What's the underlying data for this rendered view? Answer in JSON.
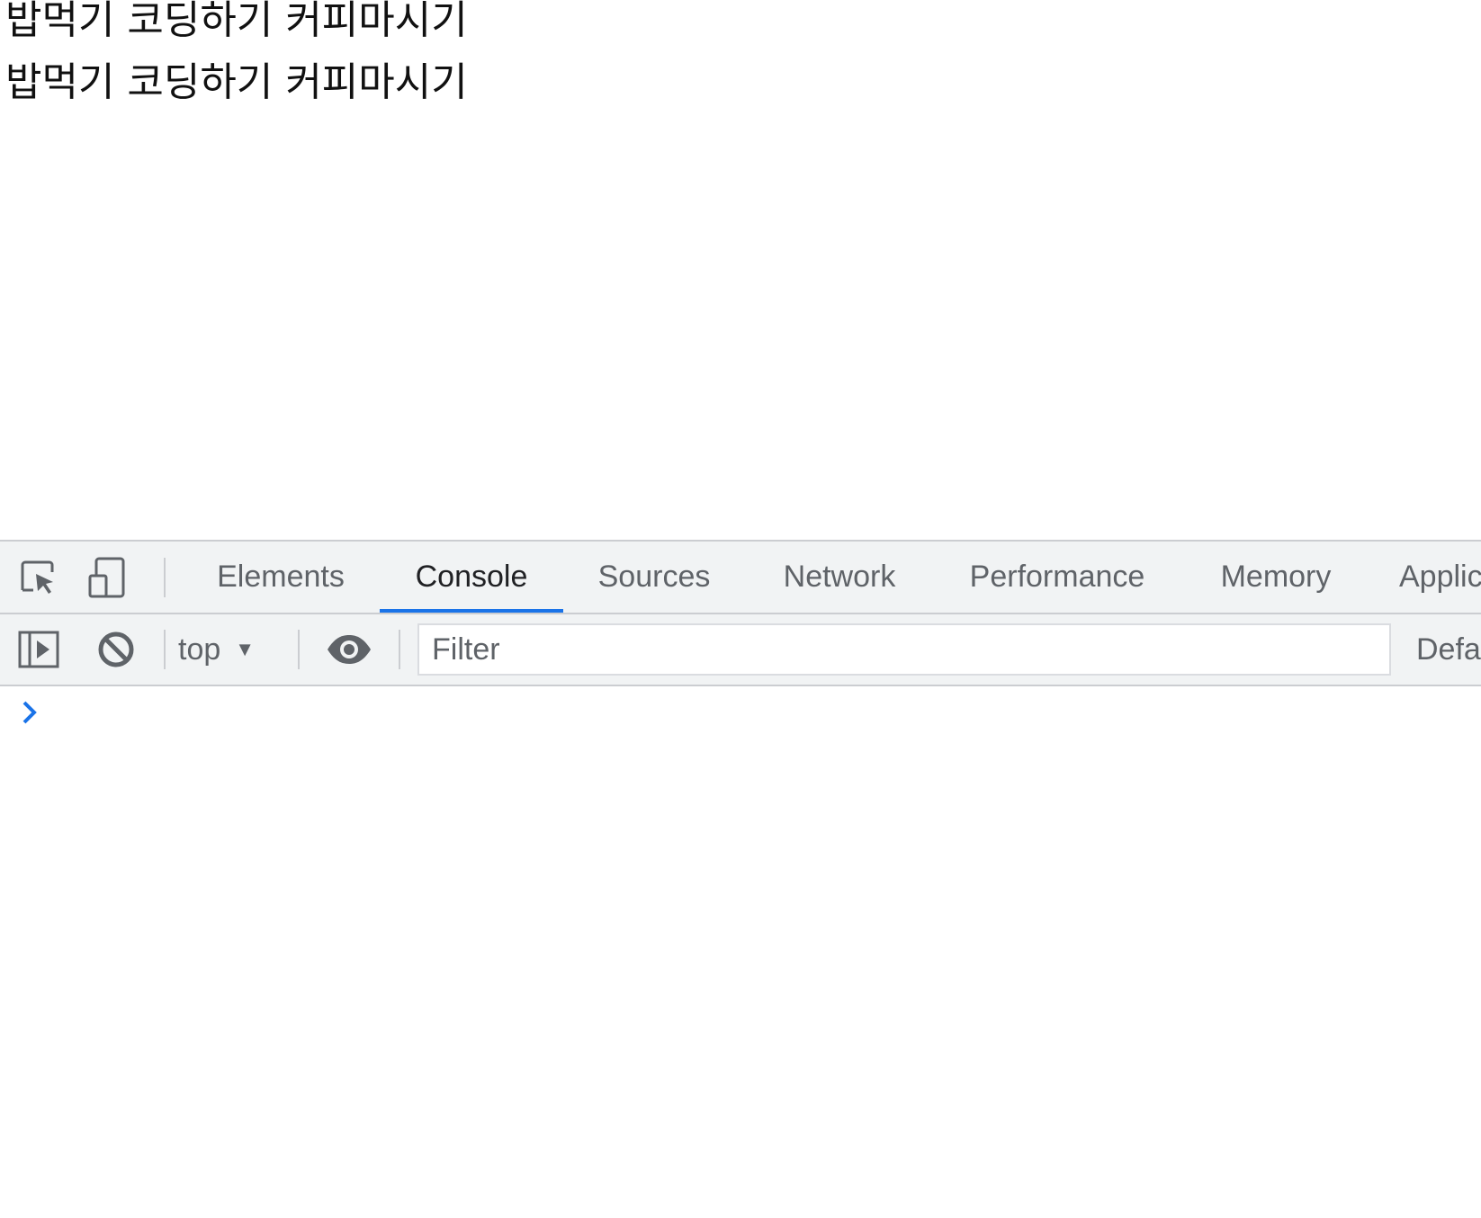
{
  "page": {
    "lines": [
      "밥먹기 코딩하기 커피마시기",
      "밥먹기 코딩하기 커피마시기"
    ]
  },
  "devtools": {
    "toolbar": {
      "inspect_icon": "inspect-element-icon",
      "device_icon": "device-toolbar-icon",
      "tabs": [
        "Elements",
        "Console",
        "Sources",
        "Network",
        "Performance",
        "Memory",
        "Applic"
      ],
      "active_tab": "Console"
    },
    "console_toolbar": {
      "sidebar_icon": "console-sidebar-icon",
      "clear_icon": "clear-console-icon",
      "context": "top",
      "live_expression_icon": "eye-icon",
      "filter_placeholder": "Filter",
      "filter_value": "",
      "levels_label": "Defa"
    },
    "console": {
      "prompt_icon": "chevron-right-icon"
    },
    "colors": {
      "accent": "#1a73e8",
      "toolbar_bg": "#f1f3f4",
      "text_muted": "#5f6368",
      "text_active": "#202124"
    }
  }
}
